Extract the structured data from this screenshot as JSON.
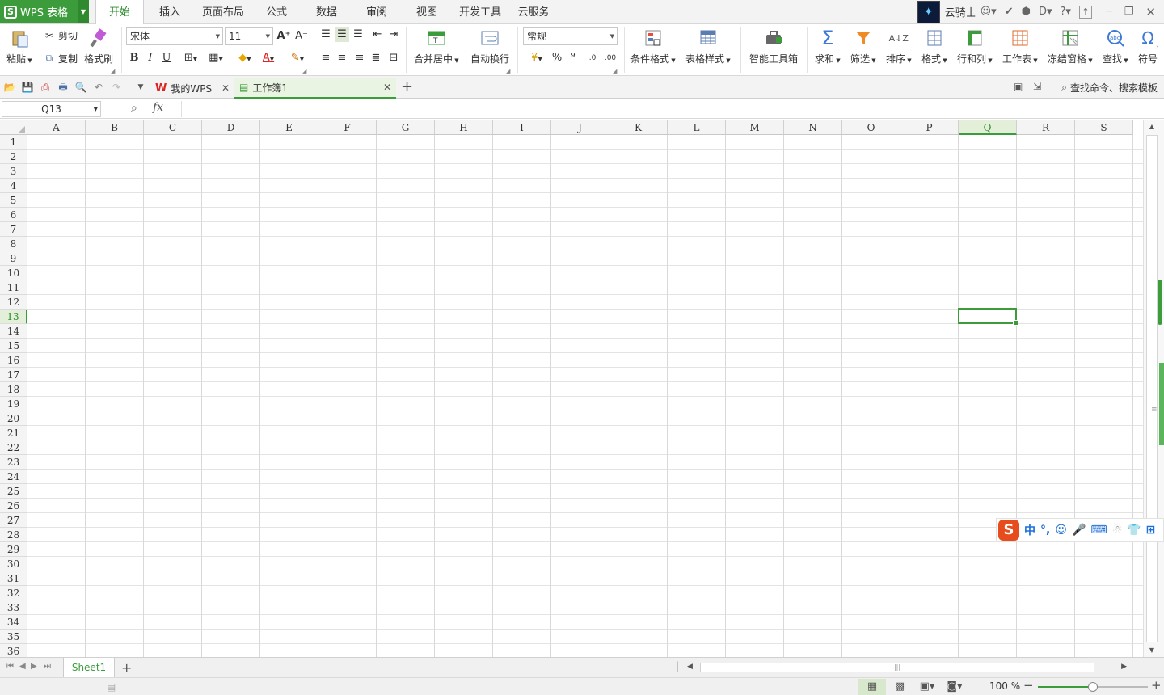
{
  "app": {
    "title": "WPS 表格"
  },
  "menu": {
    "tabs": [
      {
        "label": "开始",
        "active": true
      },
      {
        "label": "插入"
      },
      {
        "label": "页面布局"
      },
      {
        "label": "公式"
      },
      {
        "label": "数据"
      },
      {
        "label": "审阅"
      },
      {
        "label": "视图"
      },
      {
        "label": "开发工具"
      },
      {
        "label": "云服务"
      }
    ]
  },
  "user": {
    "name": "云骑士"
  },
  "ribbon": {
    "paste": "粘贴",
    "cut": "剪切",
    "copy": "复制",
    "format_painter": "格式刷",
    "font_name": "宋体",
    "font_size": "11",
    "bold": "B",
    "italic": "I",
    "underline": "U",
    "merge_center": "合并居中",
    "wrap_text": "自动换行",
    "number_format": "常规",
    "percent": "%",
    "comma": "⁹",
    "conditional_format": "条件格式",
    "table_style": "表格样式",
    "smart_toolbox": "智能工具箱",
    "sum": "求和",
    "filter": "筛选",
    "sort": "排序",
    "format": "格式",
    "rows_cols": "行和列",
    "worksheet": "工作表",
    "freeze": "冻结窗格",
    "find": "查找",
    "symbol": "符号"
  },
  "doc_tabs": [
    {
      "label": "我的WPS"
    },
    {
      "label": "工作簿1",
      "active": true
    }
  ],
  "search_command": "查找命令、搜索模板",
  "formula_bar": {
    "name_box": "Q13",
    "fx": "fx",
    "value": ""
  },
  "grid": {
    "columns": [
      "A",
      "B",
      "C",
      "D",
      "E",
      "F",
      "G",
      "H",
      "I",
      "J",
      "K",
      "L",
      "M",
      "N",
      "O",
      "P",
      "Q",
      "R",
      "S"
    ],
    "rows": [
      "1",
      "2",
      "3",
      "4",
      "5",
      "6",
      "7",
      "8",
      "9",
      "10",
      "11",
      "12",
      "13",
      "14",
      "15",
      "16",
      "17",
      "18",
      "19",
      "20",
      "21",
      "22",
      "23",
      "24",
      "25",
      "26",
      "27",
      "28",
      "29",
      "30",
      "31",
      "32",
      "33",
      "34",
      "35",
      "36"
    ],
    "selected_column": "Q",
    "selected_row": "13"
  },
  "sheets": [
    {
      "label": "Sheet1"
    }
  ],
  "status": {
    "zoom": "100 %",
    "zoom_level": 0.5
  },
  "colors": {
    "accent": "#3c9c3c",
    "ime_logo": "#e74c1d"
  }
}
